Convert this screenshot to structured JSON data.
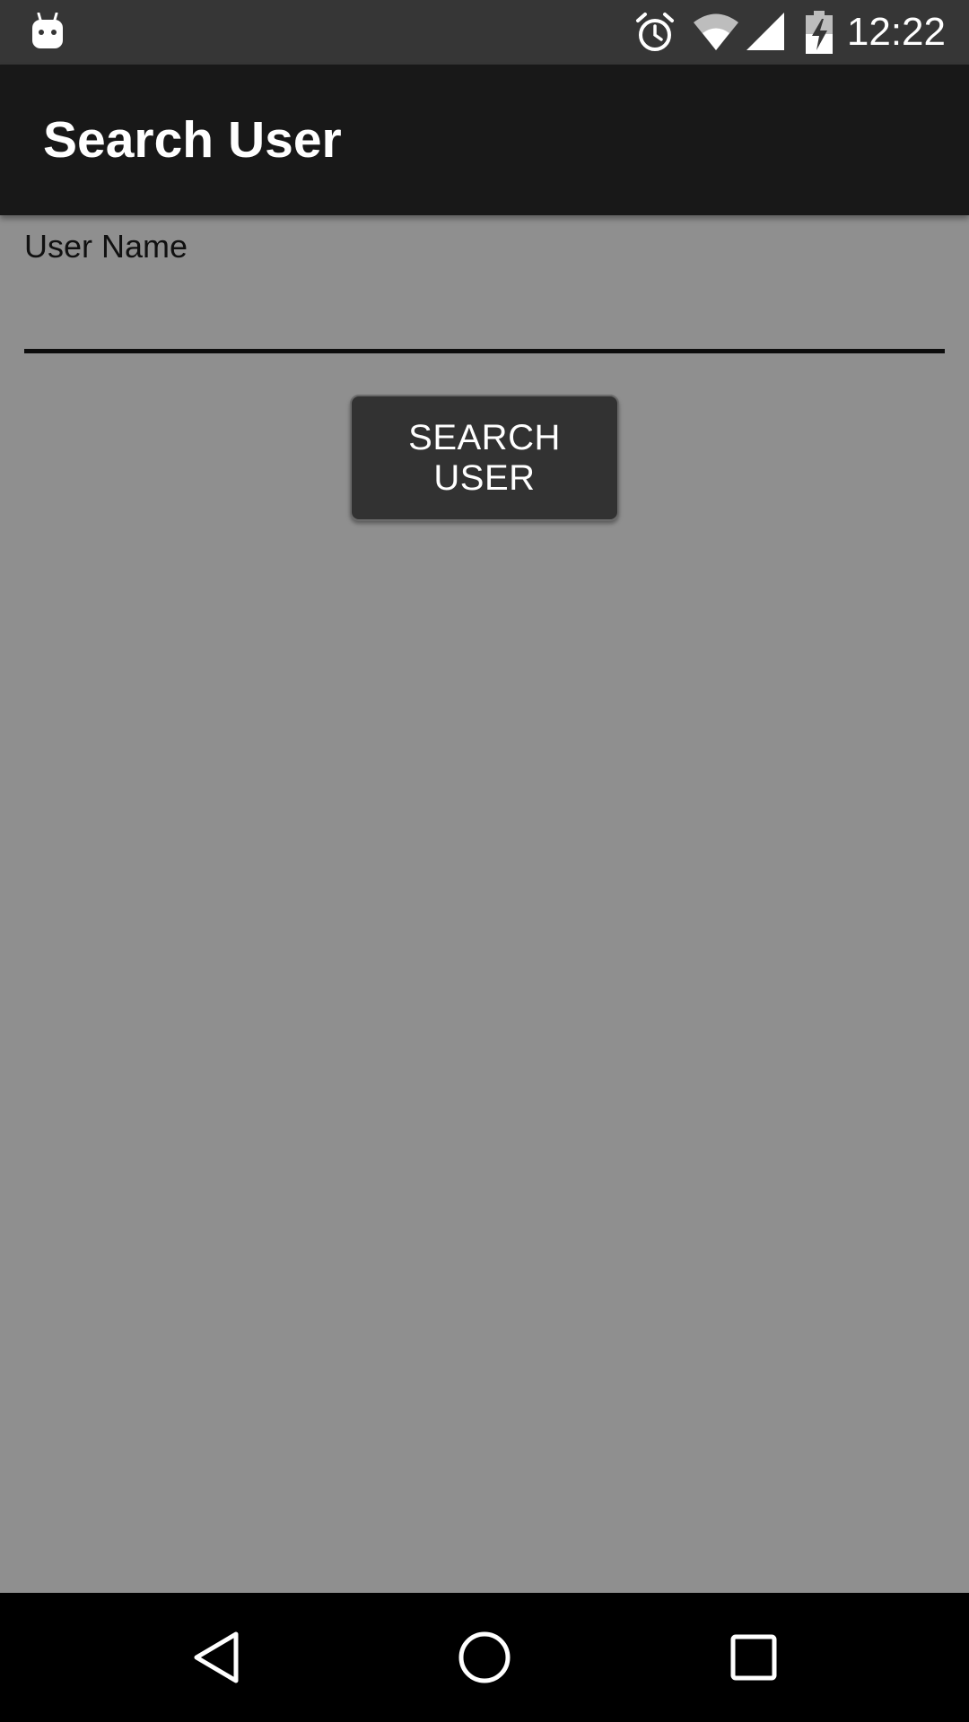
{
  "status_bar": {
    "time": "12:22",
    "icons": [
      "android-notification-icon",
      "alarm-icon",
      "wifi-icon",
      "cell-signal-icon",
      "battery-charging-icon"
    ]
  },
  "app_bar": {
    "title": "Search User"
  },
  "form": {
    "username_label": "User Name",
    "username_value": "",
    "search_button_label": "SEARCH USER"
  },
  "nav_bar": {
    "icons": [
      "back-icon",
      "home-icon",
      "recents-icon"
    ]
  },
  "colors": {
    "status_bar": "#363636",
    "app_bar": "#181818",
    "background": "#8f8f8f",
    "button": "#323232",
    "nav_bar": "#000000"
  }
}
